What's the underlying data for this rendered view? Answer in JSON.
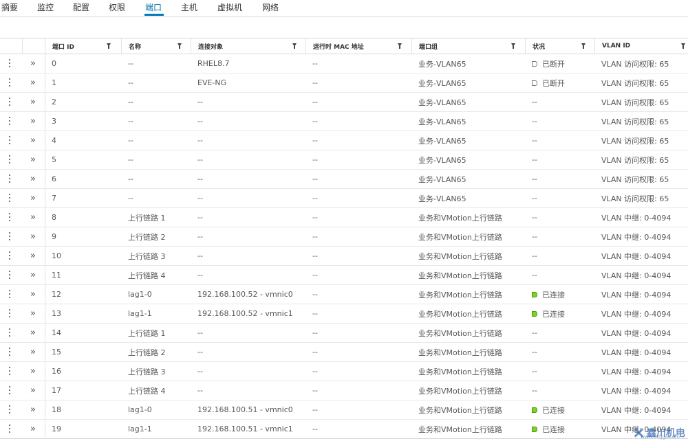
{
  "tabs": [
    {
      "label": "摘要",
      "active": false
    },
    {
      "label": "监控",
      "active": false
    },
    {
      "label": "配置",
      "active": false
    },
    {
      "label": "权限",
      "active": false
    },
    {
      "label": "端口",
      "active": true
    },
    {
      "label": "主机",
      "active": false
    },
    {
      "label": "虚拟机",
      "active": false
    },
    {
      "label": "网络",
      "active": false
    }
  ],
  "table": {
    "columns": [
      "端口 ID",
      "名称",
      "连接对象",
      "运行时 MAC 地址",
      "端口组",
      "状况",
      "VLAN ID"
    ],
    "rows": [
      {
        "id": "0",
        "name": "--",
        "connectee": "RHEL8.7",
        "mac": "--",
        "portgroup": "业务-VLAN65",
        "state": "已断开",
        "state_type": "disconnected",
        "vlan": "VLAN 访问权限: 65"
      },
      {
        "id": "1",
        "name": "--",
        "connectee": "EVE-NG",
        "mac": "--",
        "portgroup": "业务-VLAN65",
        "state": "已断开",
        "state_type": "disconnected",
        "vlan": "VLAN 访问权限: 65"
      },
      {
        "id": "2",
        "name": "--",
        "connectee": "--",
        "mac": "--",
        "portgroup": "业务-VLAN65",
        "state": "--",
        "state_type": "none",
        "vlan": "VLAN 访问权限: 65"
      },
      {
        "id": "3",
        "name": "--",
        "connectee": "--",
        "mac": "--",
        "portgroup": "业务-VLAN65",
        "state": "--",
        "state_type": "none",
        "vlan": "VLAN 访问权限: 65"
      },
      {
        "id": "4",
        "name": "--",
        "connectee": "--",
        "mac": "--",
        "portgroup": "业务-VLAN65",
        "state": "--",
        "state_type": "none",
        "vlan": "VLAN 访问权限: 65"
      },
      {
        "id": "5",
        "name": "--",
        "connectee": "--",
        "mac": "--",
        "portgroup": "业务-VLAN65",
        "state": "--",
        "state_type": "none",
        "vlan": "VLAN 访问权限: 65"
      },
      {
        "id": "6",
        "name": "--",
        "connectee": "--",
        "mac": "--",
        "portgroup": "业务-VLAN65",
        "state": "--",
        "state_type": "none",
        "vlan": "VLAN 访问权限: 65"
      },
      {
        "id": "7",
        "name": "--",
        "connectee": "--",
        "mac": "--",
        "portgroup": "业务-VLAN65",
        "state": "--",
        "state_type": "none",
        "vlan": "VLAN 访问权限: 65"
      },
      {
        "id": "8",
        "name": "上行链路 1",
        "connectee": "--",
        "mac": "--",
        "portgroup": "业务和VMotion上行链路",
        "state": "--",
        "state_type": "none",
        "vlan": "VLAN 中继: 0-4094"
      },
      {
        "id": "9",
        "name": "上行链路 2",
        "connectee": "--",
        "mac": "--",
        "portgroup": "业务和VMotion上行链路",
        "state": "--",
        "state_type": "none",
        "vlan": "VLAN 中继: 0-4094"
      },
      {
        "id": "10",
        "name": "上行链路 3",
        "connectee": "--",
        "mac": "--",
        "portgroup": "业务和VMotion上行链路",
        "state": "--",
        "state_type": "none",
        "vlan": "VLAN 中继: 0-4094"
      },
      {
        "id": "11",
        "name": "上行链路 4",
        "connectee": "--",
        "mac": "--",
        "portgroup": "业务和VMotion上行链路",
        "state": "--",
        "state_type": "none",
        "vlan": "VLAN 中继: 0-4094"
      },
      {
        "id": "12",
        "name": "lag1-0",
        "connectee": "192.168.100.52 - vmnic0",
        "mac": "--",
        "portgroup": "业务和VMotion上行链路",
        "state": "已连接",
        "state_type": "connected",
        "vlan": "VLAN 中继: 0-4094"
      },
      {
        "id": "13",
        "name": "lag1-1",
        "connectee": "192.168.100.52 - vmnic1",
        "mac": "--",
        "portgroup": "业务和VMotion上行链路",
        "state": "已连接",
        "state_type": "connected",
        "vlan": "VLAN 中继: 0-4094"
      },
      {
        "id": "14",
        "name": "上行链路 1",
        "connectee": "--",
        "mac": "--",
        "portgroup": "业务和VMotion上行链路",
        "state": "--",
        "state_type": "none",
        "vlan": "VLAN 中继: 0-4094"
      },
      {
        "id": "15",
        "name": "上行链路 2",
        "connectee": "--",
        "mac": "--",
        "portgroup": "业务和VMotion上行链路",
        "state": "--",
        "state_type": "none",
        "vlan": "VLAN 中继: 0-4094"
      },
      {
        "id": "16",
        "name": "上行链路 3",
        "connectee": "--",
        "mac": "--",
        "portgroup": "业务和VMotion上行链路",
        "state": "--",
        "state_type": "none",
        "vlan": "VLAN 中继: 0-4094"
      },
      {
        "id": "17",
        "name": "上行链路 4",
        "connectee": "--",
        "mac": "--",
        "portgroup": "业务和VMotion上行链路",
        "state": "--",
        "state_type": "none",
        "vlan": "VLAN 中继: 0-4094"
      },
      {
        "id": "18",
        "name": "lag1-0",
        "connectee": "192.168.100.51 - vmnic0",
        "mac": "--",
        "portgroup": "业务和VMotion上行链路",
        "state": "已连接",
        "state_type": "connected",
        "vlan": "VLAN 中继: 0-4094"
      },
      {
        "id": "19",
        "name": "lag1-1",
        "connectee": "192.168.100.51 - vmnic1",
        "mac": "--",
        "portgroup": "业务和VMotion上行链路",
        "state": "已连接",
        "state_type": "connected",
        "vlan": "VLAN 中继: 0-4094"
      }
    ]
  },
  "icons": {
    "row_actions": "kebab-icon",
    "row_expand": "double-chevron-right-icon",
    "column_filter": "filter-icon",
    "state_connected": "port-connected-icon",
    "state_disconnected": "port-disconnected-icon"
  },
  "colors": {
    "accent": "#0079b8",
    "connected": "#7ed321"
  },
  "watermark": {
    "text": "鑫川机电",
    "url": "www.kxtjgs.com"
  }
}
